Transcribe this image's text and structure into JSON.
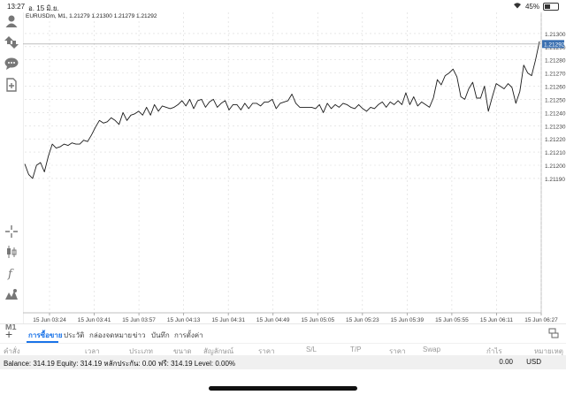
{
  "status_bar": {
    "time": "13:27",
    "date": "อ. 15 มิ.ย.",
    "battery": "45%",
    "battery_level": 0.45
  },
  "chart": {
    "title_line": "EURUSDm, M1, 1.21279 1.21300 1.21279 1.21292",
    "current_price_label": "1.21292",
    "timeframe": "M1",
    "colors": {
      "price_line": "#1a1a1a",
      "price_tag_bg": "#3a6fb0",
      "grid": "#d9d9d9"
    }
  },
  "chart_data": {
    "type": "line",
    "title": "EURUSDm, M1, 1.21279 1.21300 1.21279 1.21292",
    "ylim": [
      1.21088,
      1.21312
    ],
    "y_ticks": [
      "1.21300",
      "1.21290",
      "1.21280",
      "1.21270",
      "1.21260",
      "1.21250",
      "1.21240",
      "1.21230",
      "1.21220",
      "1.21210",
      "1.21200",
      "1.21190"
    ],
    "x_tick_labels": [
      "15 Jun 03:24",
      "15 Jun 03:41",
      "15 Jun 03:57",
      "15 Jun 04:13",
      "15 Jun 04:31",
      "15 Jun 04:49",
      "15 Jun 05:05",
      "15 Jun 05:23",
      "15 Jun 05:39",
      "15 Jun 05:55",
      "15 Jun 06:11",
      "15 Jun 06:27"
    ],
    "grid": true,
    "current_price": 1.21292,
    "series": [
      {
        "values": [
          1.21201,
          1.21193,
          1.2119,
          1.212,
          1.21202,
          1.21195,
          1.21207,
          1.21216,
          1.21213,
          1.21214,
          1.21216,
          1.21215,
          1.21217,
          1.21216,
          1.21216,
          1.21219,
          1.21218,
          1.21223,
          1.21229,
          1.21234,
          1.21232,
          1.21233,
          1.21236,
          1.21234,
          1.21231,
          1.2124,
          1.21234,
          1.21238,
          1.21239,
          1.21241,
          1.21238,
          1.21244,
          1.21238,
          1.21246,
          1.21241,
          1.21245,
          1.21244,
          1.21243,
          1.21244,
          1.21246,
          1.21249,
          1.21245,
          1.2125,
          1.21243,
          1.21249,
          1.2125,
          1.21244,
          1.21248,
          1.2125,
          1.21244,
          1.21247,
          1.21249,
          1.21242,
          1.21246,
          1.21246,
          1.21242,
          1.21247,
          1.21243,
          1.21247,
          1.21247,
          1.21245,
          1.21248,
          1.21248,
          1.2125,
          1.21243,
          1.21247,
          1.21248,
          1.21249,
          1.21254,
          1.21247,
          1.21244,
          1.21244,
          1.21244,
          1.21244,
          1.21243,
          1.21246,
          1.2124,
          1.21247,
          1.21243,
          1.21246,
          1.21244,
          1.21247,
          1.21246,
          1.21244,
          1.21243,
          1.21246,
          1.21243,
          1.21241,
          1.21244,
          1.21243,
          1.21246,
          1.21248,
          1.21244,
          1.21248,
          1.21246,
          1.21249,
          1.21246,
          1.21255,
          1.21246,
          1.21252,
          1.21245,
          1.21248,
          1.21246,
          1.21244,
          1.21251,
          1.21265,
          1.21261,
          1.21268,
          1.2127,
          1.21273,
          1.21267,
          1.21252,
          1.2125,
          1.21258,
          1.21263,
          1.21251,
          1.21251,
          1.2126,
          1.21241,
          1.21252,
          1.21262,
          1.2126,
          1.21258,
          1.21262,
          1.21259,
          1.21247,
          1.21256,
          1.21276,
          1.2127,
          1.21268,
          1.2128,
          1.21294
        ]
      }
    ]
  },
  "bottom": {
    "tabs": [
      "การซื้อขาย",
      "ประวัติ",
      "กล่องจดหมาย",
      "ข่าว",
      "บันทึก",
      "การตั้งค่า"
    ],
    "columns": [
      "คำสั่ง",
      "เวลา",
      "ประเภท",
      "ขนาด",
      "สัญลักษณ์",
      "ราคา",
      "S/L",
      "T/P",
      "ราคา",
      "Swap",
      "กำไร",
      "หมายเหตุ"
    ],
    "balance_text": "Balance: 314.19 Equity: 314.19 หลักประกัน: 0.00 ฟรี: 314.19 Level: 0.00%",
    "total": "0.00",
    "currency": "USD"
  }
}
